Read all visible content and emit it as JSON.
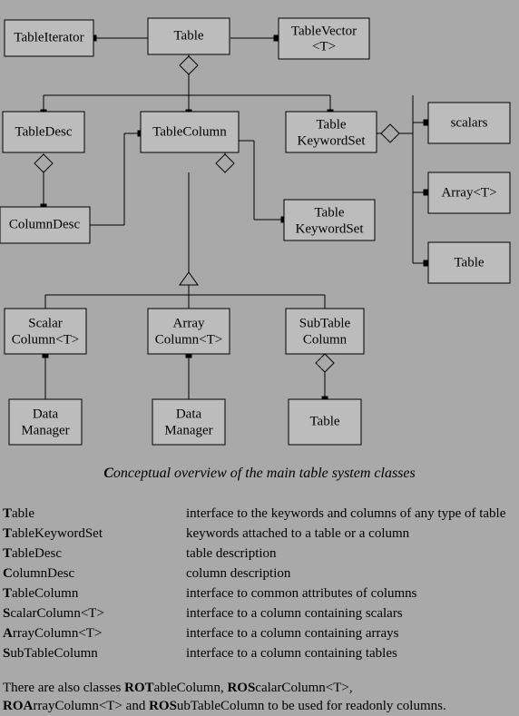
{
  "boxes": {
    "tableIterator": "TableIterator",
    "table": "Table",
    "tableVector": "TableVector <T>",
    "tableDesc": "TableDesc",
    "tableColumn": "TableColumn",
    "tableKeywordSet1a": "Table",
    "tableKeywordSet1b": "KeywordSet",
    "tableKeywordSet2a": "Table",
    "tableKeywordSet2b": "KeywordSet",
    "scalars": "scalars",
    "arrayT": "Array<T>",
    "table2": "Table",
    "columnDesc": "ColumnDesc",
    "scalarColumn1": "Scalar",
    "scalarColumn2": "Column<T>",
    "arrayColumn1": "Array",
    "arrayColumn2": "Column<T>",
    "subTableColumn1": "SubTable",
    "subTableColumn2": "Column",
    "dataManager1": "Data",
    "dataManager1b": "Manager",
    "dataManager2": "Data",
    "dataManager2b": "Manager",
    "table3": "Table"
  },
  "caption": "Conceptual overview of the main table system classes",
  "definitions": [
    {
      "term": "Table",
      "bold": "T",
      "rest": "able",
      "defn": "interface to the keywords and columns of any type of table"
    },
    {
      "term": "TableKeywordSet",
      "bold": "T",
      "rest": "ableKeywordSet",
      "defn": "keywords attached to a table or a column"
    },
    {
      "term": "TableDesc",
      "bold": "T",
      "rest": "ableDesc",
      "defn": "table description"
    },
    {
      "term": "ColumnDesc",
      "bold": "C",
      "rest": "olumnDesc",
      "defn": "column description"
    },
    {
      "term": "TableColumn",
      "bold": "T",
      "rest": "ableColumn",
      "defn": "interface to common attributes of columns"
    },
    {
      "term": "ScalarColumn<T>",
      "bold": "S",
      "rest": "calarColumn<T>",
      "defn": "interface to a column containing scalars"
    },
    {
      "term": "ArrayColumn<T>",
      "bold": "A",
      "rest": "rrayColumn<T>",
      "defn": "interface to a column containing arrays"
    },
    {
      "term": "SubTableColumn",
      "bold": "S",
      "rest": "ubTableColumn",
      "defn": "interface to a column containing tables"
    }
  ],
  "footnote": {
    "prefix": "There are also classes ",
    "c1": "ROT",
    "c1r": "ableColumn, ",
    "c2": "ROS",
    "c2r": "calarColumn<T>,",
    "c3": "ROA",
    "c3r": "rrayColumn<T> and ",
    "c4": "ROS",
    "c4r": "ubTableColumn to be used for readonly columns."
  }
}
